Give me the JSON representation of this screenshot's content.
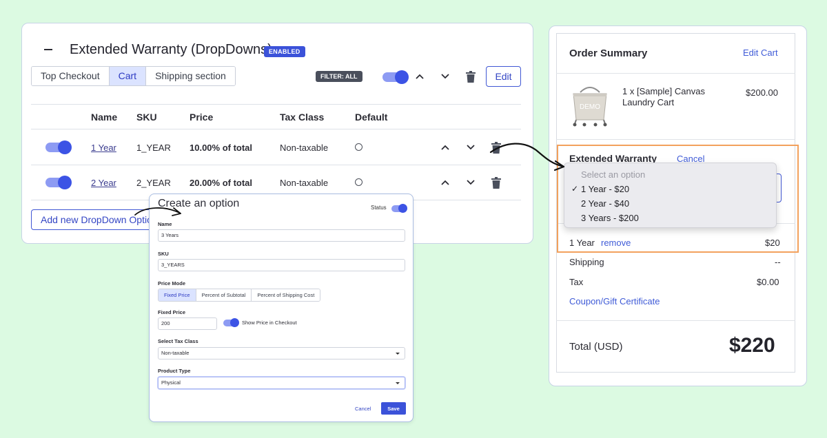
{
  "warranty_panel": {
    "title": "Extended Warranty (DropDowns)",
    "status_badge": "ENABLED",
    "tabs": [
      {
        "label": "Top Checkout"
      },
      {
        "label": "Cart"
      },
      {
        "label": "Shipping section"
      }
    ],
    "active_tab": "Cart",
    "filter_badge": "FILTER: ALL",
    "edit_label": "Edit",
    "columns": [
      "Name",
      "SKU",
      "Price",
      "Tax Class",
      "Default"
    ],
    "rows": [
      {
        "name": "1 Year",
        "sku": "1_YEAR",
        "price": "10.00% of total",
        "tax_class": "Non-taxable",
        "enabled": true,
        "default": false
      },
      {
        "name": "2 Year",
        "sku": "2_YEAR",
        "price": "20.00% of total",
        "tax_class": "Non-taxable",
        "enabled": true,
        "default": false
      }
    ],
    "add_button_label": "Add new DropDown Option"
  },
  "create_dialog": {
    "title": "Create an option",
    "status_label": "Status",
    "name_label": "Name",
    "name_value": "3 Years",
    "sku_label": "SKU",
    "sku_value": "3_YEARS",
    "price_mode_label": "Price Mode",
    "price_modes": [
      "Fixed Price",
      "Percent of Subtotal",
      "Percent of Shipping Cost"
    ],
    "active_price_mode": "Fixed Price",
    "fixed_price_label": "Fixed Price",
    "fixed_price_value": "200",
    "show_price_label": "Show Price in Checkout",
    "tax_class_label": "Select Tax Class",
    "tax_class_value": "Non-taxable",
    "product_type_label": "Product Type",
    "product_type_value": "Physical",
    "cancel_label": "Cancel",
    "save_label": "Save"
  },
  "order_summary": {
    "title": "Order Summary",
    "edit_cart_label": "Edit Cart",
    "product_name": "1 x [Sample] Canvas Laundry Cart",
    "product_price": "$200.00",
    "product_image_text": "DEMO",
    "warranty_title": "Extended Warranty",
    "warranty_cancel_label": "Cancel",
    "dropdown": {
      "placeholder": "Select an option",
      "options": [
        "1 Year - $20",
        "2 Year - $40",
        "3 Years - $200"
      ],
      "selected_index": 0,
      "check_mark": "✓"
    },
    "selected_warranty": "1 Year",
    "remove_label": "remove",
    "warranty_price": "$20",
    "shipping_label": "Shipping",
    "shipping_value": "--",
    "tax_label": "Tax",
    "tax_value": "$0.00",
    "coupon_label": "Coupon/Gift Certificate",
    "total_label": "Total (USD)",
    "total_value": "$220"
  },
  "colors": {
    "background": "#dcfae2",
    "accent": "#3b52d9",
    "highlight_border": "#f3a15c"
  }
}
